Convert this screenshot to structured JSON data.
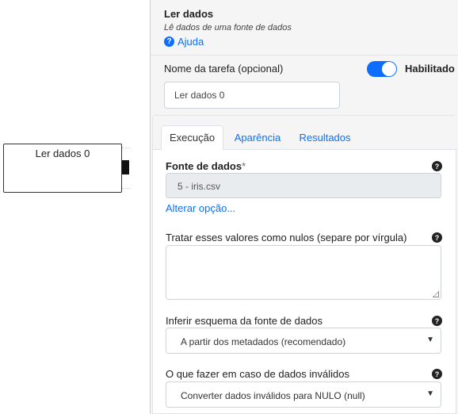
{
  "canvas": {
    "node_title": "Ler dados 0"
  },
  "panel": {
    "title": "Ler dados",
    "subtitle": "Lê dados de uma fonte de dados",
    "help_label": "Ajuda",
    "task_name_label": "Nome da tarefa (opcional)",
    "enabled_label": "Habilitado",
    "enabled": true,
    "task_name_value": "Ler dados 0"
  },
  "tabs": [
    {
      "label": "Execução",
      "active": true
    },
    {
      "label": "Aparência",
      "active": false
    },
    {
      "label": "Resultados",
      "active": false
    }
  ],
  "execution": {
    "data_source_label": "Fonte de dados",
    "required_mark": "*",
    "data_source_value": "5 - iris.csv",
    "change_option_link": "Alterar opção...",
    "null_values_label": "Tratar esses valores como nulos (separe por vírgula)",
    "null_values_value": "",
    "infer_schema_label": "Inferir esquema da fonte de dados",
    "infer_schema_value": "A partir dos metadados (recomendado)",
    "invalid_data_label": "O que fazer em caso de dados inválidos",
    "invalid_data_value": "Converter dados inválidos para NULO (null)"
  },
  "colors": {
    "accent": "#0d6efd",
    "panel_bg": "#f5f5f5",
    "readonly_bg": "#e9ecef"
  }
}
